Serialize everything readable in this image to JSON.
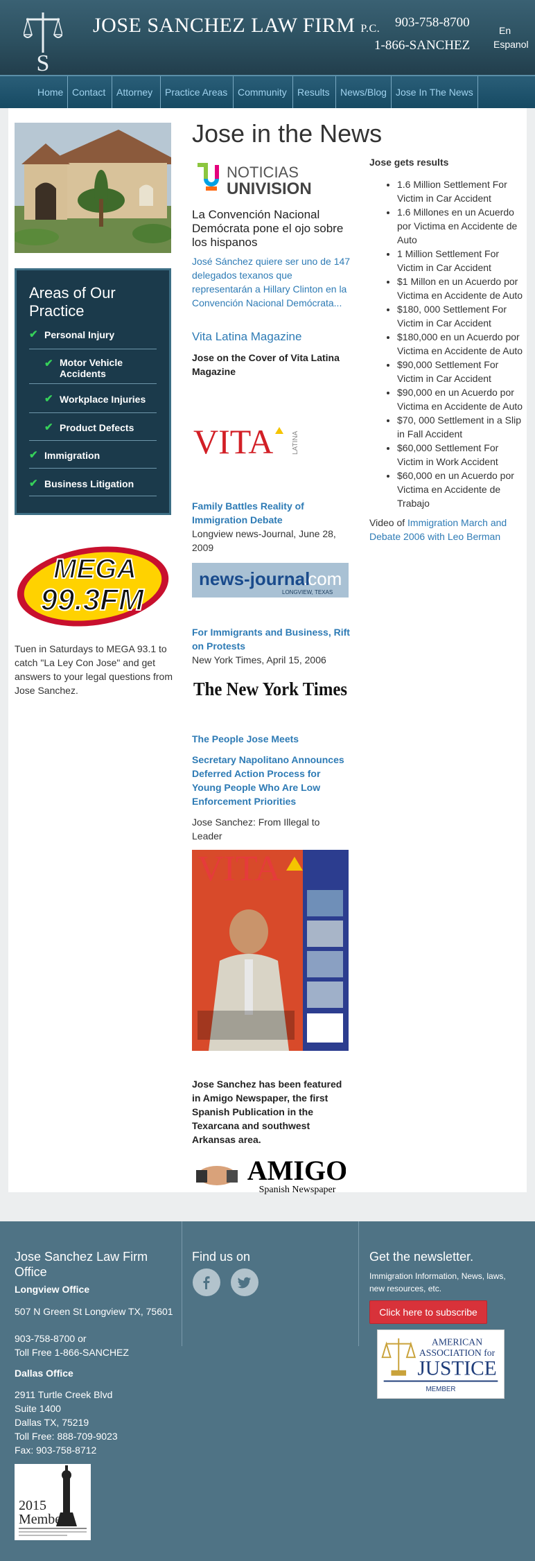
{
  "header": {
    "firm_name": "JOSE SANCHEZ LAW FIRM",
    "firm_suffix": "P.C.",
    "phone_primary": "903-758-8700",
    "phone_secondary": "1-866-SANCHEZ",
    "lang_en": "En",
    "lang_es": "Espanol"
  },
  "nav": {
    "items": [
      "Home",
      "Contact",
      "Attorney",
      "Practice Areas",
      "Community",
      "Results",
      "News/Blog",
      "Jose In The News"
    ]
  },
  "sidebar": {
    "areas_title": "Areas of Our Practice",
    "areas": [
      {
        "label": "Personal Injury",
        "level": 0
      },
      {
        "label": "Motor Vehicle Accidents",
        "level": 1
      },
      {
        "label": "Workplace Injuries",
        "level": 1
      },
      {
        "label": "Product Defects",
        "level": 1
      },
      {
        "label": "Immigration",
        "level": 0
      },
      {
        "label": "Business Litigation",
        "level": 0
      }
    ],
    "mega_logo_top": "MEGA",
    "mega_logo_bottom": "99.3FM",
    "mega_text": "Tuen in Saturdays to MEGA 93.1 to catch \"La Ley Con Jose\" and get answers to your legal questions from Jose Sanchez."
  },
  "content": {
    "page_title": "Jose in the News",
    "univision_top": "NOTICIAS",
    "univision_bottom": "UNIVISION",
    "convention_title": "La Convención Nacional Demócrata pone el ojo sobre los hispanos",
    "convention_link": "José Sánchez quiere ser uno de 147 delegados texanos que representarán a Hillary Clinton en la Convención Nacional Demócrata...",
    "vita_link": "Vita Latina Magazine",
    "vita_cover_text": "Jose on the Cover of Vita Latina Magazine",
    "vita_logo": "VITA",
    "vita_logo_sub": "LATINA",
    "news1_title": "Family Battles Reality of Immigration Debate",
    "news1_meta": "Longview news-Journal, June 28, 2009",
    "nj_logo": "news-journal",
    "nj_logo_com": ".com",
    "nj_logo_sub": "LONGVIEW, TEXAS",
    "news2_title": "For Immigrants and Business, Rift on Protests",
    "news2_meta": "New York Times, April 15, 2006",
    "nyt_logo": "The New York Times",
    "people_title": "The People Jose Meets",
    "napolitano_title": "Secretary Napolitano Announces Deferred Action Process for Young People Who Are Low Enforcement Priorities",
    "illegal_leader": "Jose Sanchez: From Illegal to Leader",
    "amigo_text": "Jose Sanchez has been featured in Amigo Newspaper, the first Spanish Publication in the Texarcana and southwest Arkansas area.",
    "amigo_logo": "AMIGO",
    "amigo_logo_sub": "Spanish Newspaper"
  },
  "results": {
    "title": "Jose gets results",
    "items": [
      "1.6 Million Settlement For Victim in Car Accident",
      "1.6 Millones en un Acuerdo por Victima en Accidente de Auto",
      "1 Million Settlement For Victim in Car Accident",
      "$1 Millon en un Acuerdo por Victima en Accidente de Auto",
      "$180, 000 Settlement For Victim in Car Accident",
      "$180,000 en un Acuerdo por Victima en Accidente de Auto",
      "$90,000 Settlement For Victim in Car Accident",
      "$90,000 en un Acuerdo por Victima en Accidente de Auto",
      "$70, 000 Settlement in a Slip in Fall Accident",
      "$60,000 Settlement For Victim in Work Accident",
      "$60,000 en un Acuerdo por Victima en Accidente de Trabajo"
    ],
    "video_prefix": "Video of ",
    "video_link": "Immigration March and Debate 2006 with Leo Berman"
  },
  "footer": {
    "office_title": "Jose Sanchez Law Firm Office",
    "longview_title": "Longview Office",
    "longview_lines": [
      "507 N Green St Longview TX, 75601",
      "903-758-8700 or",
      "Toll Free 1-866-SANCHEZ"
    ],
    "dallas_title": "Dallas Office",
    "dallas_lines": [
      "2911 Turtle Creek Blvd",
      "Suite 1400",
      "Dallas TX, 75219",
      "Toll Free: 888-709-9023",
      "Fax: 903-758-8712"
    ],
    "find_us": "Find us on",
    "newsletter_title": "Get the newsletter.",
    "newsletter_desc": "Immigration Information, News, laws, new resources, etc.",
    "subscribe_label": "Click here to subscribe",
    "aaj_line1": "AMERICAN",
    "aaj_line2": "ASSOCIATION for",
    "aaj_line3": "JUSTICE",
    "aaj_line4": "MEMBER",
    "member_year": "2015",
    "member_word": "Member"
  }
}
